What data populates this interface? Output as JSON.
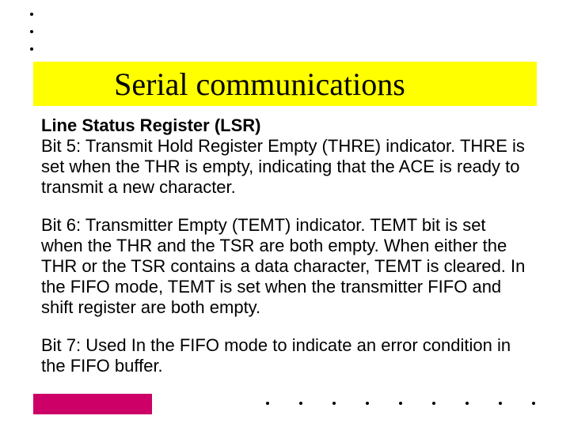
{
  "title": "Serial communications",
  "heading": "Line Status Register (LSR)",
  "bit5": "Bit 5: Transmit Hold Register Empty (THRE) indicator. THRE is set when the THR is empty, indicating that the ACE is ready to transmit a new character.",
  "bit6": "Bit 6: Transmitter Empty (TEMT) indicator. TEMT bit is set when the THR and the TSR are both empty. When either the THR or the TSR contains a data character, TEMT is cleared. In the FIFO mode, TEMT is set when the transmitter FIFO and shift register are both empty.",
  "bit7": "Bit 7: Used In the FIFO mode to indicate an error condition in the FIFO buffer."
}
